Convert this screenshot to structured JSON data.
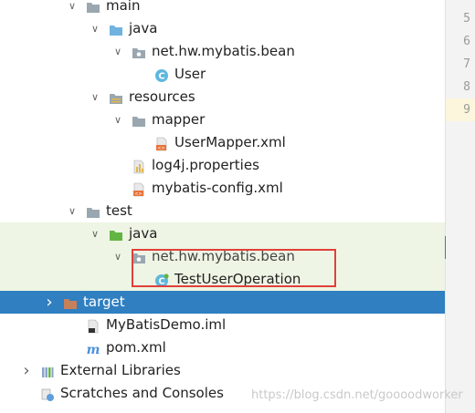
{
  "tree": {
    "rows": [
      {
        "label": "main",
        "depth": 3,
        "expand": "down",
        "icon": "folder-icon",
        "cut": true
      },
      {
        "label": "java",
        "depth": 4,
        "expand": "down",
        "icon": "source-folder-icon"
      },
      {
        "label": "net.hw.mybatis.bean",
        "depth": 5,
        "expand": "down",
        "icon": "package-icon"
      },
      {
        "label": "User",
        "depth": 6,
        "expand": "none",
        "icon": "java-class-icon"
      },
      {
        "label": "resources",
        "depth": 4,
        "expand": "down",
        "icon": "resources-folder-icon"
      },
      {
        "label": "mapper",
        "depth": 5,
        "expand": "down",
        "icon": "folder-icon"
      },
      {
        "label": "UserMapper.xml",
        "depth": 6,
        "expand": "none",
        "icon": "xml-file-icon"
      },
      {
        "label": "log4j.properties",
        "depth": 5,
        "expand": "none",
        "icon": "properties-file-icon"
      },
      {
        "label": "mybatis-config.xml",
        "depth": 5,
        "expand": "none",
        "icon": "xml-file-icon"
      },
      {
        "label": "test",
        "depth": 3,
        "expand": "down",
        "icon": "folder-icon"
      },
      {
        "label": "java",
        "depth": 4,
        "expand": "down",
        "icon": "test-folder-icon",
        "bg": "test"
      },
      {
        "label": "net.hw.mybatis.bean",
        "depth": 5,
        "expand": "down",
        "icon": "package-icon",
        "bg": "test"
      },
      {
        "label": "TestUserOperation",
        "depth": 6,
        "expand": "none",
        "icon": "java-test-class-icon",
        "bg": "test"
      },
      {
        "label": "target",
        "depth": 2,
        "expand": "right",
        "icon": "excluded-folder-icon",
        "selected": true
      },
      {
        "label": "MyBatisDemo.iml",
        "depth": 3,
        "expand": "none",
        "icon": "iml-file-icon"
      },
      {
        "label": "pom.xml",
        "depth": 3,
        "expand": "none",
        "icon": "maven-icon"
      },
      {
        "label": "External Libraries",
        "depth": 1,
        "expand": "right",
        "icon": "libraries-icon"
      },
      {
        "label": "Scratches and Consoles",
        "depth": 1,
        "expand": "none",
        "icon": "scratches-icon"
      }
    ]
  },
  "gutter": {
    "line_numbers": [
      "5",
      "6",
      "7",
      "8",
      "9"
    ],
    "current": "9"
  },
  "watermark": "https://blog.csdn.net/goooodworker",
  "colors": {
    "selection": "#2f7fc1",
    "test_bg": "#eef5e4",
    "highlight": "#e0403a"
  }
}
